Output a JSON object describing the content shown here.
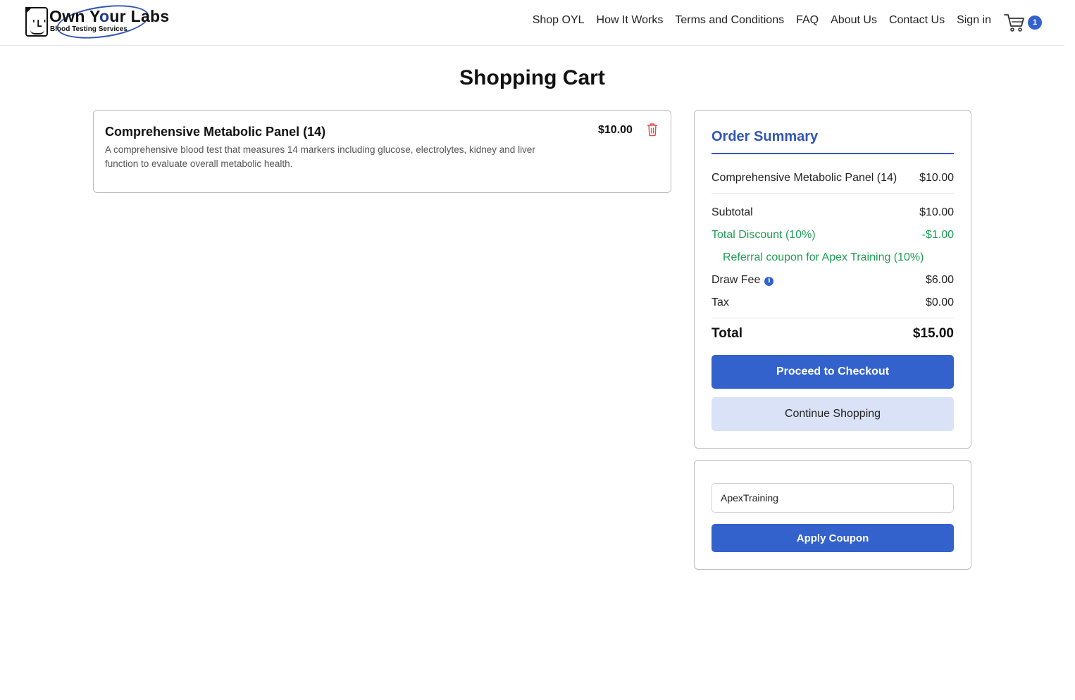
{
  "brand": {
    "name_part1": "Own Y",
    "name_accent": "o",
    "name_part2": "ur Labs",
    "tagline": "Blood Testing Services",
    "accent_color": "#3356b5"
  },
  "nav": {
    "items": [
      "Shop OYL",
      "How It Works",
      "Terms and Conditions",
      "FAQ",
      "About Us",
      "Contact Us",
      "Sign in"
    ],
    "cart_count": "1",
    "cart_icon": "shopping-cart-icon"
  },
  "page": {
    "title": "Shopping Cart"
  },
  "cart_items": [
    {
      "name": "Comprehensive Metabolic Panel (14)",
      "description": "A comprehensive blood test that measures 14 markers including glucose, electrolytes, kidney and liver function to evaluate overall metabolic health.",
      "price": "$10.00",
      "remove_icon": "trash-icon"
    }
  ],
  "summary": {
    "title": "Order Summary",
    "line_item_name": "Comprehensive Metabolic Panel (14)",
    "line_item_price": "$10.00",
    "subtotal_label": "Subtotal",
    "subtotal_value": "$10.00",
    "discount_label": "Total Discount (10%)",
    "discount_value": "-$1.00",
    "coupon_note": "Referral coupon for Apex Training (10%)",
    "draw_fee_label": "Draw Fee",
    "draw_fee_value": "$6.00",
    "tax_label": "Tax",
    "tax_value": "$0.00",
    "total_label": "Total",
    "total_value": "$15.00",
    "checkout_label": "Proceed to Checkout",
    "continue_label": "Continue Shopping"
  },
  "coupon": {
    "value": "ApexTraining",
    "apply_label": "Apply Coupon"
  },
  "colors": {
    "primary": "#3362cc",
    "discount_green": "#1f9d55",
    "secondary_button": "#d9e2f6",
    "trash_red": "#d9534f"
  }
}
